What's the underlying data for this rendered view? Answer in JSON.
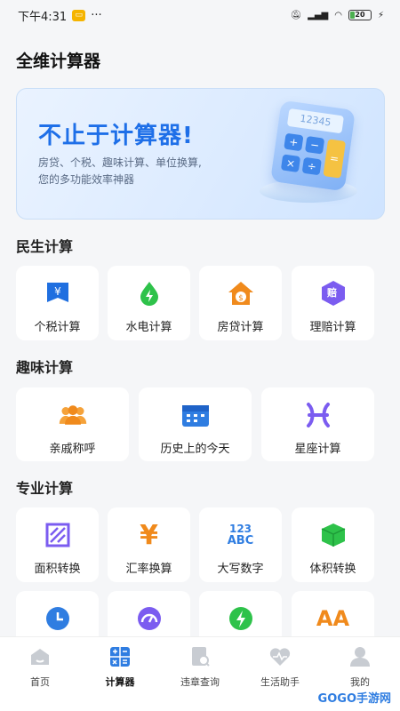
{
  "status": {
    "time": "下午4:31",
    "dots": "···",
    "battery": "20"
  },
  "title": "全维计算器",
  "banner": {
    "headline": "不止于计算器!",
    "line1": "房贷、个税、趣味计算、单位换算,",
    "line2": "您的多功能效率神器",
    "screen": "12345"
  },
  "sections": [
    {
      "title": "民生计算",
      "items": [
        {
          "label": "个税计算",
          "icon": "tax-icon",
          "color": "#1f6fe0"
        },
        {
          "label": "水电计算",
          "icon": "water-electric-icon",
          "color": "#2ec24a"
        },
        {
          "label": "房贷计算",
          "icon": "house-loan-icon",
          "color": "#f08a1c"
        },
        {
          "label": "理赔计算",
          "icon": "claim-icon",
          "color": "#7b5cf0",
          "badge": "赔"
        }
      ]
    },
    {
      "title": "趣味计算",
      "items": [
        {
          "label": "亲戚称呼",
          "icon": "people-icon",
          "color": "#f08a1c"
        },
        {
          "label": "历史上的今天",
          "icon": "calendar-icon",
          "color": "#2f7de1"
        },
        {
          "label": "星座计算",
          "icon": "pisces-icon",
          "color": "#7b5cf0"
        }
      ]
    },
    {
      "title": "专业计算",
      "items": [
        {
          "label": "面积转换",
          "icon": "area-icon",
          "color": "#7b5cf0"
        },
        {
          "label": "汇率换算",
          "icon": "yen-icon",
          "color": "#f08a1c",
          "glyph": "¥"
        },
        {
          "label": "大写数字",
          "icon": "number-icon",
          "color": "#2f7de1",
          "glyph1": "123",
          "glyph2": "ABC"
        },
        {
          "label": "体积转换",
          "icon": "cube-icon",
          "color": "#2ec24a"
        },
        {
          "label": "",
          "icon": "clock-icon",
          "color": "#2f7de1"
        },
        {
          "label": "",
          "icon": "gauge-icon",
          "color": "#7b5cf0"
        },
        {
          "label": "",
          "icon": "bolt-icon",
          "color": "#2ec24a"
        },
        {
          "label": "",
          "icon": "font-size-icon",
          "color": "#f08a1c",
          "glyph": "AA"
        }
      ]
    }
  ],
  "nav": [
    {
      "label": "首页",
      "icon": "home-icon"
    },
    {
      "label": "计算器",
      "icon": "calculator-icon",
      "active": true
    },
    {
      "label": "违章查询",
      "icon": "violation-icon"
    },
    {
      "label": "生活助手",
      "icon": "heart-icon"
    },
    {
      "label": "我的",
      "icon": "profile-icon"
    }
  ],
  "watermark": "GOGO手游网"
}
